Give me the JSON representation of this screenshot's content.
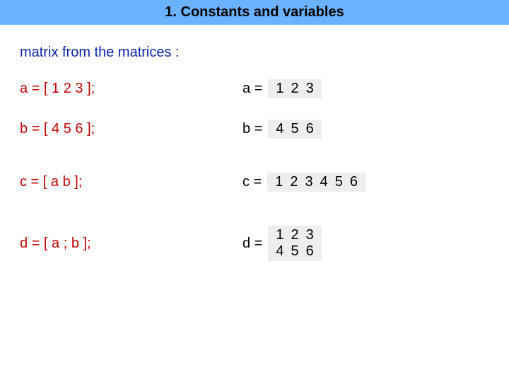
{
  "title": "1. Constants and variables",
  "subtitle": "matrix from the matrices :",
  "rows": [
    {
      "code": "a = [ 1  2  3 ];",
      "label": "a =",
      "matrix": [
        [
          "1",
          "2",
          "3"
        ]
      ]
    },
    {
      "code": "b = [ 4  5  6 ];",
      "label": "b =",
      "matrix": [
        [
          "4",
          "5",
          "6"
        ]
      ]
    },
    {
      "code": "c = [ a  b ];",
      "label": "c =",
      "matrix": [
        [
          "1",
          "2",
          "3",
          "4",
          "5",
          "6"
        ]
      ]
    },
    {
      "code": "d = [ a ; b ];",
      "label": "d =",
      "matrix": [
        [
          "1",
          "2",
          "3"
        ],
        [
          "4",
          "5",
          "6"
        ]
      ]
    }
  ]
}
